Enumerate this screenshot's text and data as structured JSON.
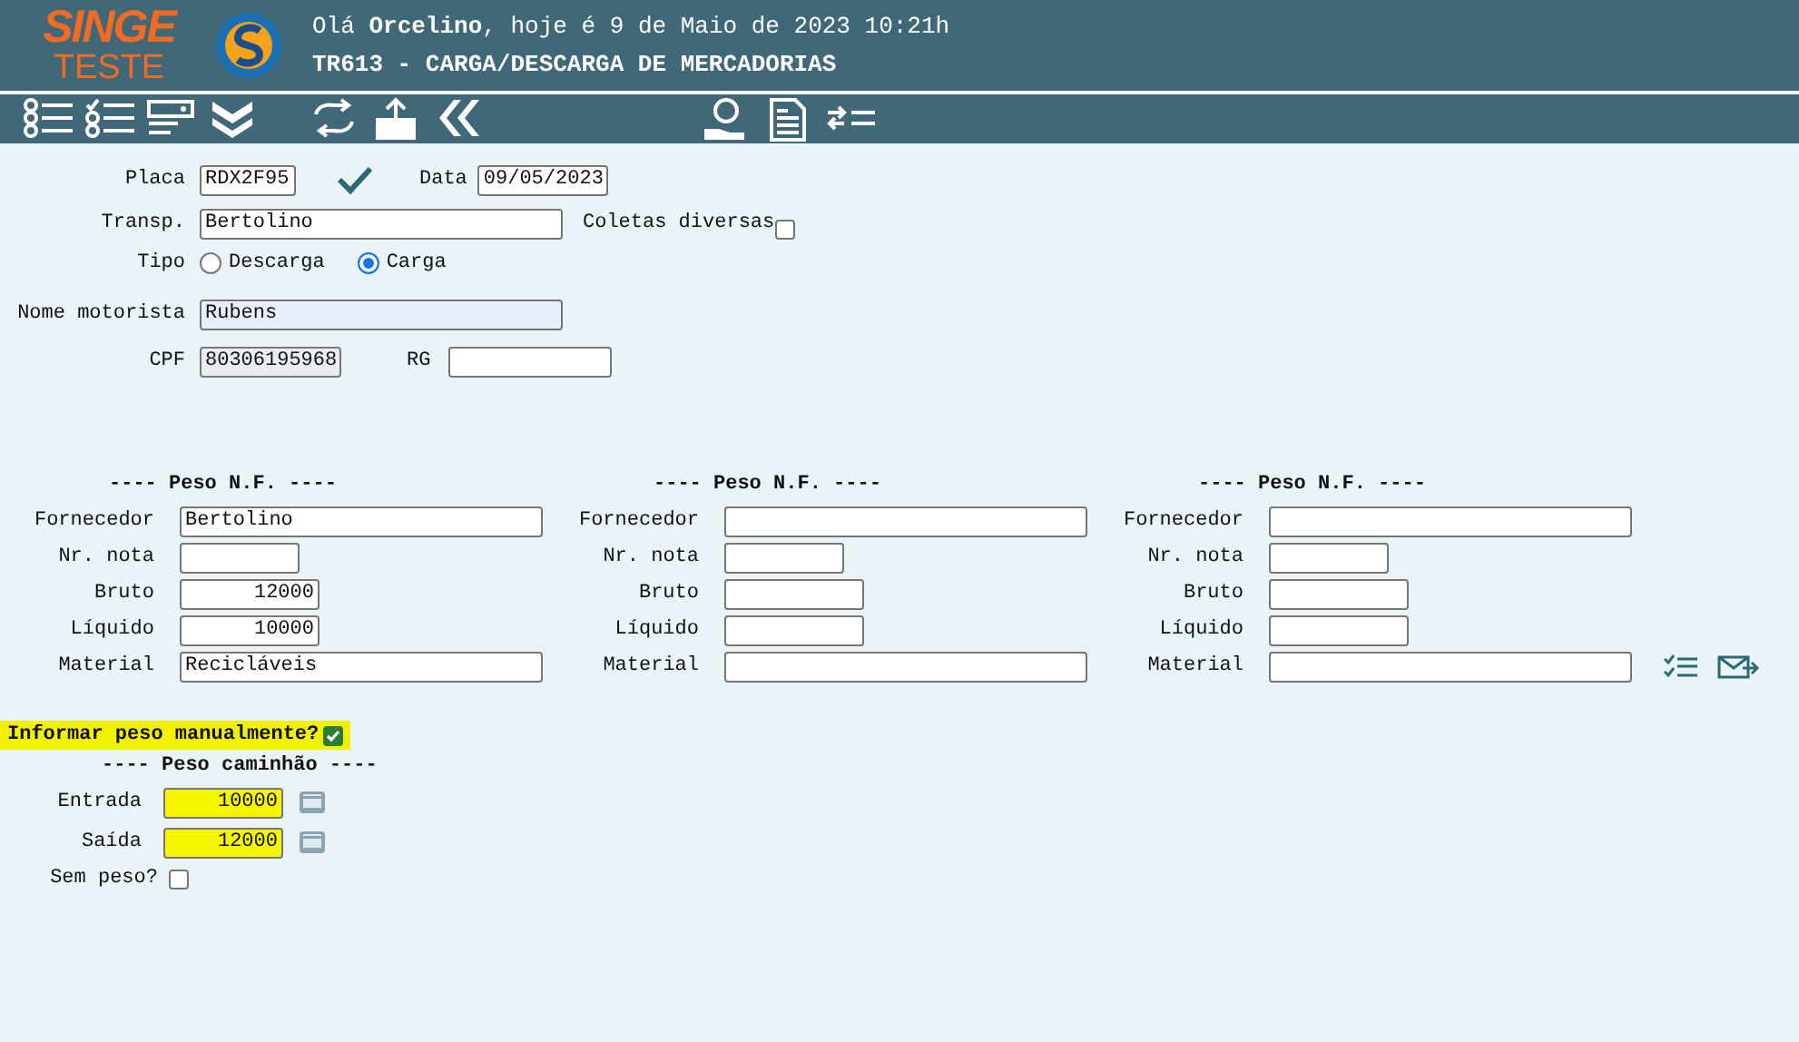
{
  "header": {
    "logo": "SINGE",
    "logo_sub": "TESTE",
    "greeting": "Olá **Orcelino**, hoje é 9 de Maio de 2023 10:21h",
    "title": "TR613 - CARGA/DESCARGA DE MERCADORIAS"
  },
  "form": {
    "placa": {
      "label": "Placa",
      "value": "RDX2F95"
    },
    "data": {
      "label": "Data",
      "value": "09/05/2023"
    },
    "transp": {
      "label": "Transp.",
      "value": "Bertolino"
    },
    "coletas": {
      "label": "Coletas diversas",
      "checked": false
    },
    "tipo": {
      "label": "Tipo",
      "options": [
        {
          "label": "Descarga",
          "selected": false
        },
        {
          "label": "Carga",
          "selected": true
        }
      ]
    },
    "motorista": {
      "label": "Nome motorista",
      "value": "Rubens"
    },
    "cpf": {
      "label": "CPF",
      "value": "80306195968"
    },
    "rg": {
      "label": "RG"
    }
  },
  "notas": [
    {
      "heading": "---- Peso N.F. ----",
      "fields": [
        {
          "label": "Fornecedor",
          "kind": "wide",
          "value": "Bertolino"
        },
        {
          "label": "Nr. nota",
          "kind": "short"
        },
        {
          "label": "Bruto",
          "kind": "number",
          "value": "12000"
        },
        {
          "label": "Líquido",
          "kind": "number",
          "value": "10000"
        },
        {
          "label": "Material",
          "kind": "wide",
          "value": "Recicláveis"
        }
      ]
    },
    {
      "heading": "---- Peso N.F. ----",
      "fields": [
        {
          "label": "Fornecedor",
          "kind": "wide"
        },
        {
          "label": "Nr. nota",
          "kind": "short"
        },
        {
          "label": "Bruto",
          "kind": "number"
        },
        {
          "label": "Líquido",
          "kind": "number"
        },
        {
          "label": "Material",
          "kind": "wide"
        }
      ]
    },
    {
      "heading": "---- Peso N.F. ----",
      "fields": [
        {
          "label": "Fornecedor",
          "kind": "wide"
        },
        {
          "label": "Nr. nota",
          "kind": "short"
        },
        {
          "label": "Bruto",
          "kind": "number"
        },
        {
          "label": "Líquido",
          "kind": "number"
        },
        {
          "label": "Material",
          "kind": "wide"
        }
      ]
    }
  ],
  "manual": {
    "label": "Informar peso manualmente?",
    "checked": true
  },
  "caminhao": {
    "heading": "---- Peso caminhão ----",
    "fields": [
      {
        "label": "Entrada",
        "value": "10000"
      },
      {
        "label": "Saída",
        "value": "12000"
      }
    ],
    "sem_peso": {
      "label": "Sem peso?",
      "checked": false
    }
  }
}
